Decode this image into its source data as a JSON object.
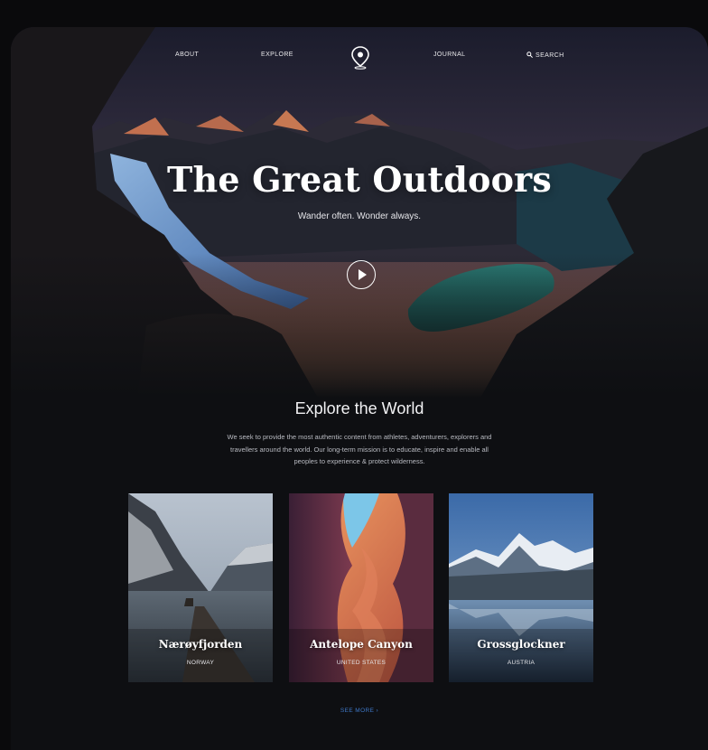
{
  "nav": {
    "about": "ABOUT",
    "explore": "EXPLORE",
    "journal": "JOURNAL",
    "search": "SEARCH"
  },
  "hero": {
    "title": "The Great Outdoors",
    "subtitle": "Wander often. Wonder always."
  },
  "explore": {
    "title": "Explore the World",
    "description": "We seek to provide the most authentic content from athletes, adventurers, explorers and travellers around the world. Our long-term mission is to educate, inspire and enable all peoples to experience & protect wilderness."
  },
  "cards": [
    {
      "name": "Nærøyfjorden",
      "country": "NORWAY"
    },
    {
      "name": "Antelope Canyon",
      "country": "UNITED STATES"
    },
    {
      "name": "Grossglockner",
      "country": "AUSTRIA"
    }
  ],
  "see_more": "SEE MORE ›",
  "colors": {
    "background": "#0e0f12",
    "accent_link": "#3f79c9",
    "lake": "#1f6a66"
  }
}
